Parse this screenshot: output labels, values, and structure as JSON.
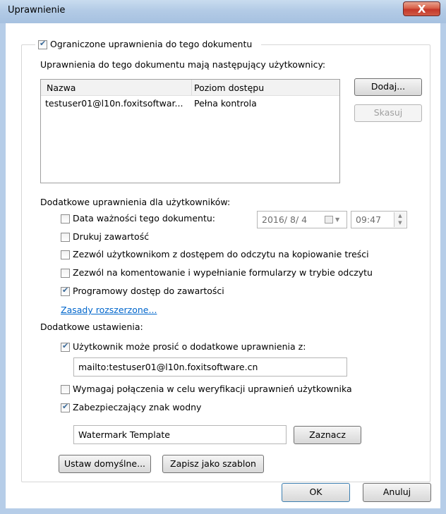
{
  "window": {
    "title": "Uprawnienie",
    "close_symbol": "X"
  },
  "restricted": {
    "label": "Ograniczone uprawnienia do tego dokumentu",
    "checked": true
  },
  "users_section": {
    "heading": "Uprawnienia do tego dokumentu mają następujący użytkownicy:",
    "columns": [
      "Nazwa",
      "Poziom dostępu"
    ],
    "rows": [
      {
        "name": "testuser01@l10n.foxitsoftwar...",
        "level": "Pełna kontrola"
      }
    ],
    "add_label": "Dodaj...",
    "delete_label": "Skasuj"
  },
  "extra_permissions": {
    "heading": "Dodatkowe uprawnienia dla użytkowników:",
    "expiry": {
      "label": "Data ważności tego dokumentu:",
      "checked": false,
      "date": "2016/ 8/ 4",
      "time": "09:47"
    },
    "print": {
      "label": "Drukuj zawartość",
      "checked": false
    },
    "copy": {
      "label": "Zezwól użytkownikom z dostępem do odczytu na kopiowanie treści",
      "checked": false
    },
    "comment": {
      "label": "Zezwól na komentowanie i wypełnianie formularzy w trybie odczytu",
      "checked": false
    },
    "programmatic": {
      "label": "Programowy dostęp do zawartości",
      "checked": true
    },
    "advanced_link": "Zasady rozszerzone..."
  },
  "additional_settings": {
    "heading": "Dodatkowe ustawienia:",
    "request": {
      "label": "Użytkownik może prosić o dodatkowe uprawnienia z:",
      "checked": true,
      "value": "mailto:testuser01@l10n.foxitsoftware.cn"
    },
    "verify": {
      "label": "Wymagaj połączenia w celu weryfikacji uprawnień użytkownika",
      "checked": false
    },
    "watermark": {
      "label": "Zabezpieczający znak wodny",
      "checked": true,
      "value": "Watermark Template",
      "select_label": "Zaznacz"
    },
    "set_default_label": "Ustaw domyślne...",
    "save_template_label": "Zapisz jako szablon"
  },
  "footer": {
    "ok_label": "OK",
    "cancel_label": "Anuluj"
  }
}
